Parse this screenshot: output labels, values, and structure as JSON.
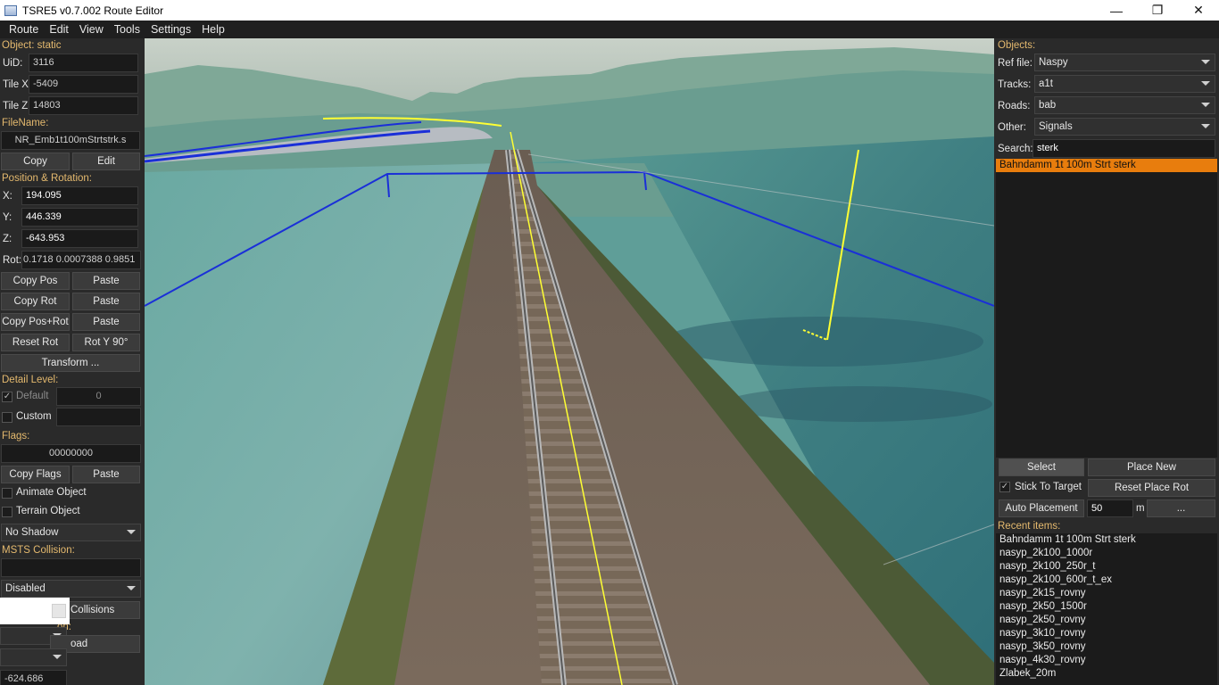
{
  "window": {
    "title": "TSRE5 v0.7.002 Route Editor",
    "minimize_glyph": "—",
    "maximize_glyph": "❐",
    "close_glyph": "✕"
  },
  "menu": [
    "Route",
    "Edit",
    "View",
    "Tools",
    "Settings",
    "Help"
  ],
  "left": {
    "object_header": "Object: static",
    "uid_label": "UiD:",
    "uid_value": "3116",
    "tilex_label": "Tile X:",
    "tilex_value": "-5409",
    "tilez_label": "Tile Z:",
    "tilez_value": "14803",
    "filename_header": "FileName:",
    "filename_value": "NR_Emb1t100mStrtstrk.s",
    "copy_label": "Copy",
    "edit_label": "Edit",
    "posrot_header": "Position & Rotation:",
    "x_label": "X:",
    "x_value": "194.095",
    "y_label": "Y:",
    "y_value": "446.339",
    "z_label": "Z:",
    "z_value": "-643.953",
    "rot_label": "Rot:",
    "rot_value": "0.1718 0.0007388 0.9851",
    "copy_pos": "Copy Pos",
    "paste_1": "Paste",
    "copy_rot": "Copy Rot",
    "paste_2": "Paste",
    "copy_posrot": "Copy Pos+Rot",
    "paste_3": "Paste",
    "reset_rot": "Reset Rot",
    "rot_y90": "Rot Y 90°",
    "transform": "Transform ...",
    "detail_header": "Detail Level:",
    "default_label": "Default",
    "default_value": "0",
    "custom_label": "Custom",
    "flags_header": "Flags:",
    "flags_value": "00000000",
    "copy_flags": "Copy Flags",
    "paste_4": "Paste",
    "animate_label": "Animate Object",
    "terrain_label": "Terrain Object",
    "shadow_value": "No Shadow",
    "msts_header": "MSTS Collision:",
    "disabled_value": "Disabled",
    "collisions_label": "Collisions",
    "partial_header": "on:",
    "load_label": "oad",
    "bottom_value": "-624.686"
  },
  "right": {
    "objects_header": "Objects:",
    "reffile_label": "Ref file:",
    "reffile_value": "Naspy",
    "tracks_label": "Tracks:",
    "tracks_value": "a1t",
    "roads_label": "Roads:",
    "roads_value": "bab",
    "other_label": "Other:",
    "other_value": "Signals",
    "search_label": "Search:",
    "search_value": "sterk",
    "selected_item": "Bahndamm 1t 100m Strt sterk",
    "select_btn": "Select",
    "placenew_btn": "Place New",
    "stick_label": "Stick To Target",
    "resetplacerot_btn": "Reset Place Rot",
    "autoplace_btn": "Auto Placement",
    "autoplace_value": "50",
    "unit_m": "m",
    "more_btn": "...",
    "recent_header": "Recent items:",
    "recent_items": [
      "Bahndamm 1t 100m Strt sterk",
      "nasyp_2k100_1000r",
      "nasyp_2k100_250r_t",
      "nasyp_2k100_600r_t_ex",
      "nasyp_2k15_rovny",
      "nasyp_2k50_1500r",
      "nasyp_2k50_rovny",
      "nasyp_3k10_rovny",
      "nasyp_3k50_rovny",
      "nasyp_4k30_rovny",
      "Zlabek_20m"
    ]
  },
  "colors": {
    "accent_orange": "#e87d0d",
    "section_header": "#e4b96e",
    "water": "#5f9e98",
    "wire_blue": "#1a2fd8",
    "marker_yellow": "#ffff33"
  }
}
